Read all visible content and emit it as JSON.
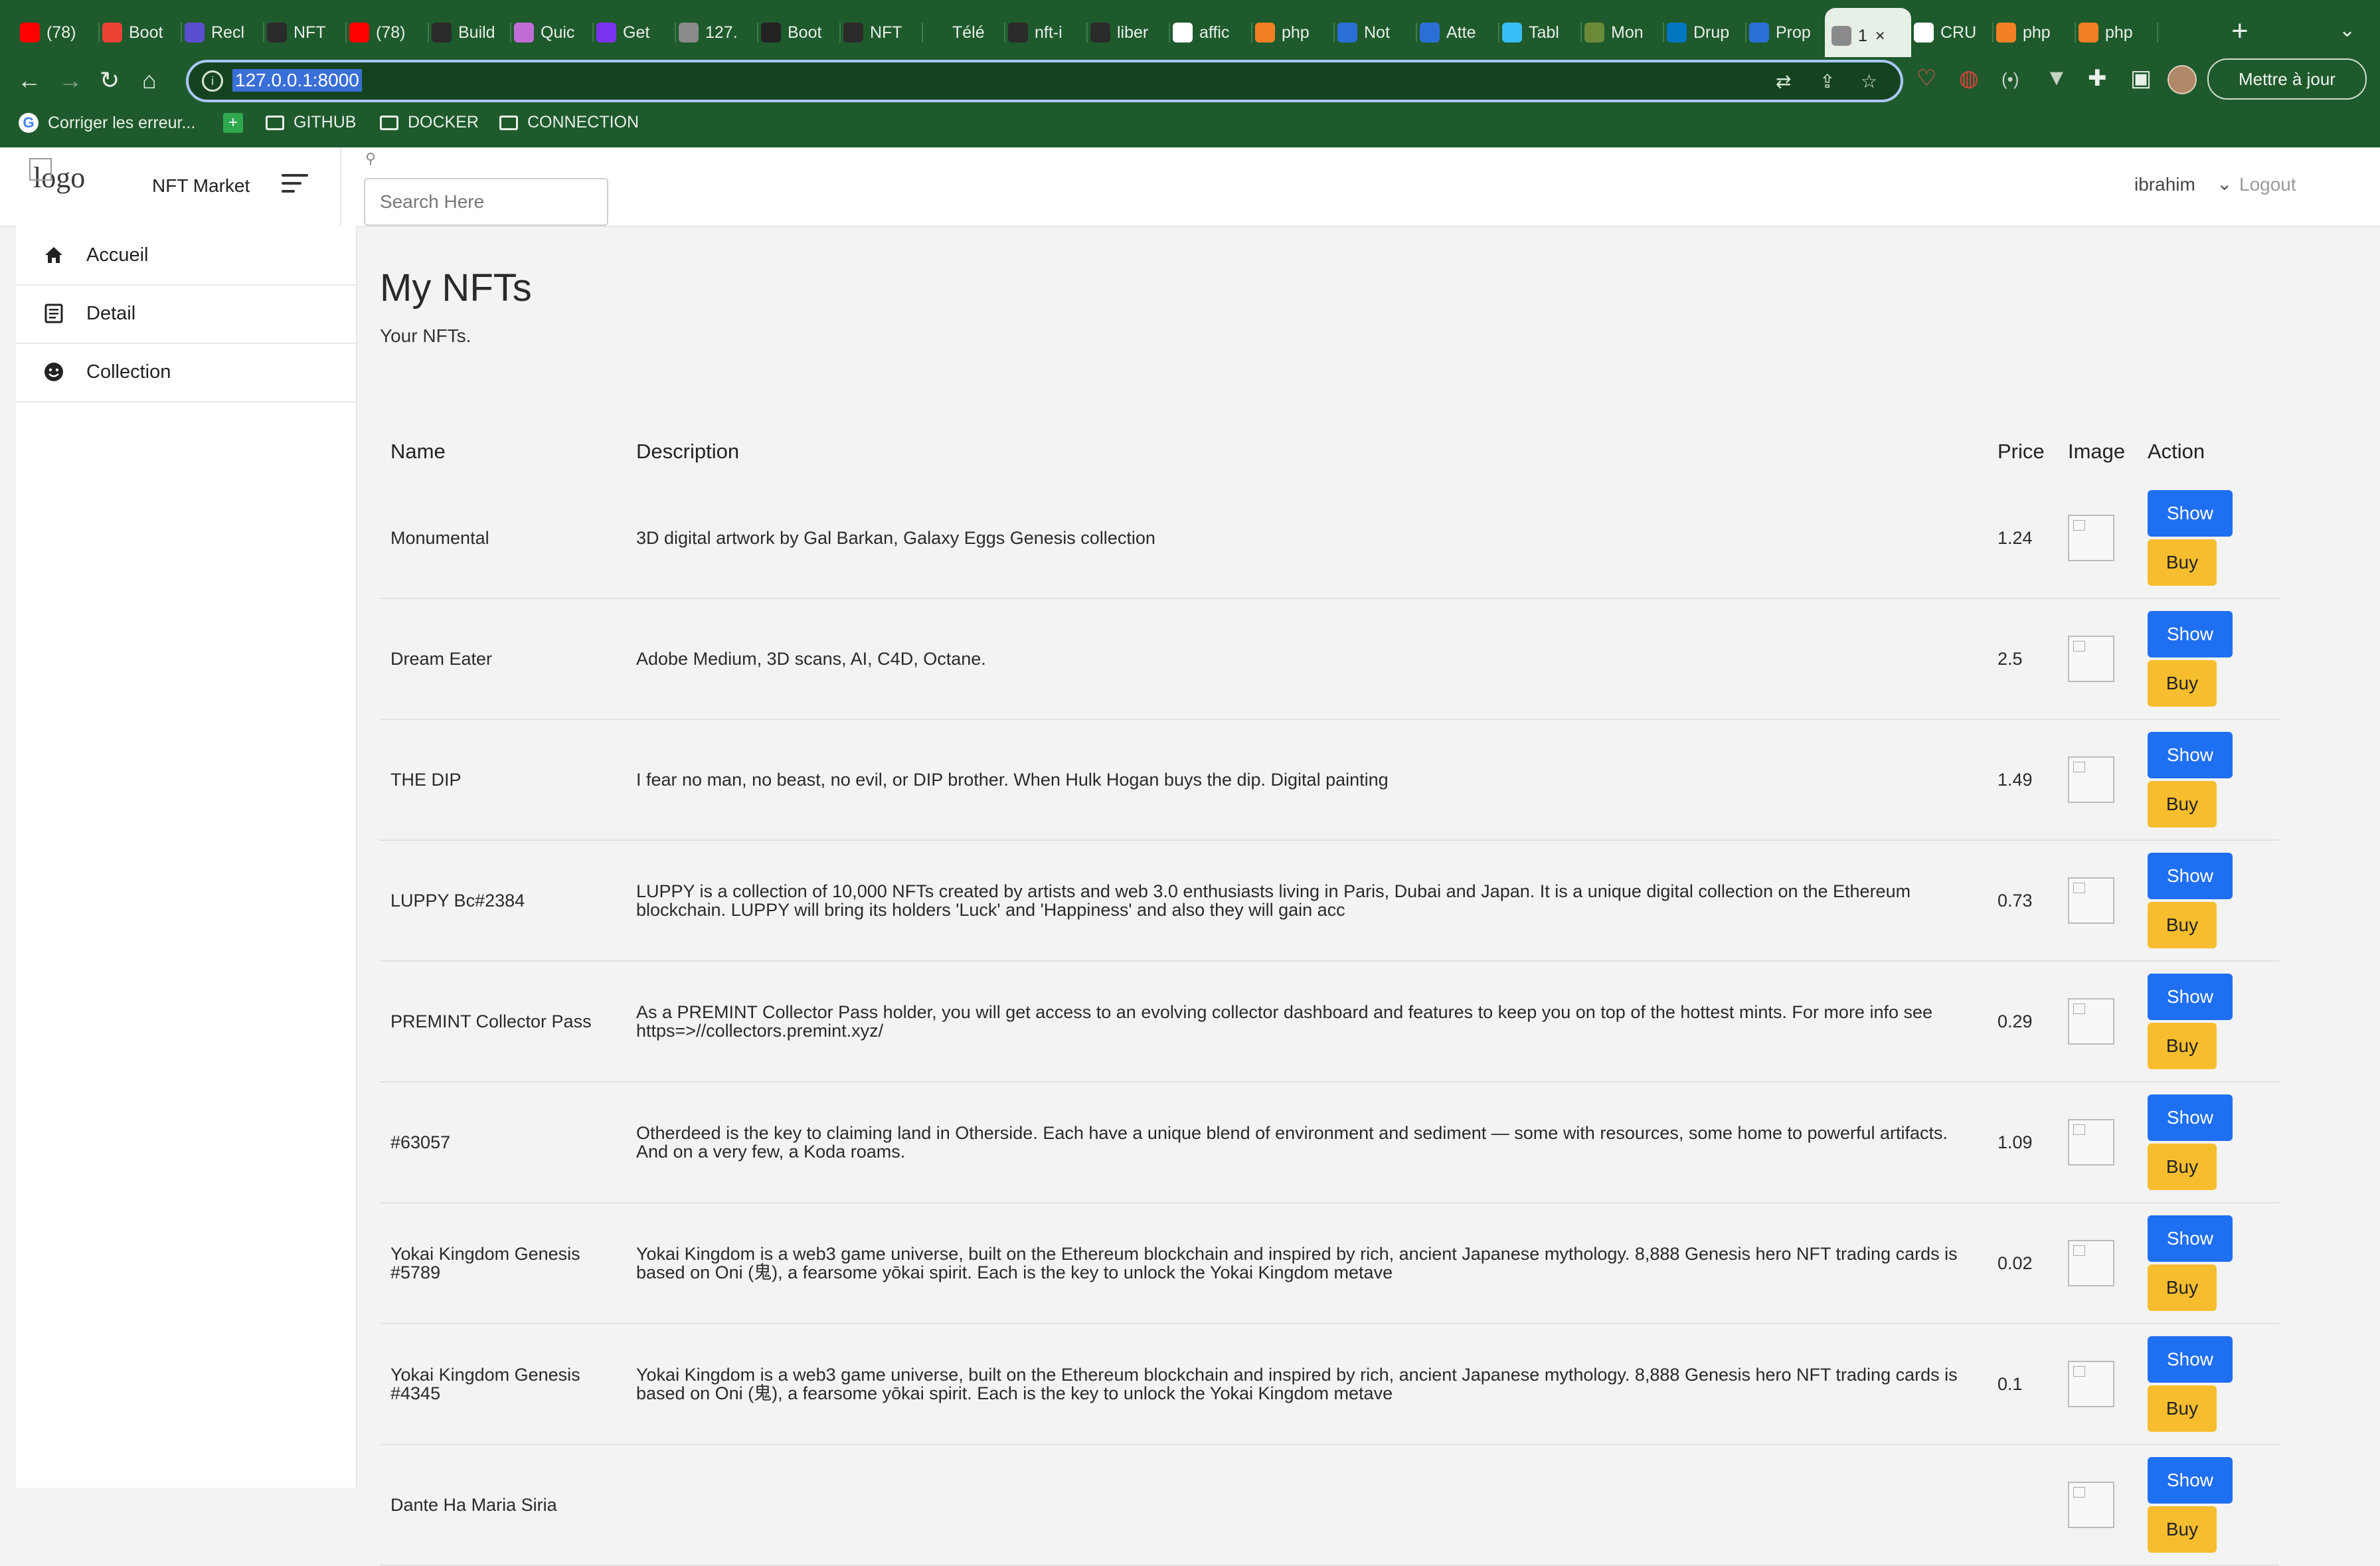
{
  "browser": {
    "tabs": [
      {
        "label": "(78)",
        "color": "#ff0000",
        "icon": "youtube-icon"
      },
      {
        "label": "Boot",
        "color": "#ea4335",
        "icon": "gmail-icon"
      },
      {
        "label": "Recl",
        "color": "#5a4fcf",
        "icon": "app-icon"
      },
      {
        "label": "NFT",
        "color": "#2b2b2b",
        "icon": "app-icon"
      },
      {
        "label": "(78)",
        "color": "#ff0000",
        "icon": "youtube-icon"
      },
      {
        "label": "Build",
        "color": "#2b2b2b",
        "icon": "app-icon"
      },
      {
        "label": "Quic",
        "color": "#c06bd6",
        "icon": "app-icon"
      },
      {
        "label": "Get",
        "color": "#7b32f0",
        "icon": "bootstrap-icon"
      },
      {
        "label": "127.",
        "color": "#8a8a8a",
        "icon": "page-icon"
      },
      {
        "label": "Boot",
        "color": "#222222",
        "icon": "github-icon"
      },
      {
        "label": "NFT",
        "color": "#2b2b2b",
        "icon": "app-icon"
      },
      {
        "label": "Télé",
        "color": "#1f5a2c",
        "icon": "download-icon"
      },
      {
        "label": "nft-i",
        "color": "#2b2b2b",
        "icon": "app-icon"
      },
      {
        "label": "liber",
        "color": "#2b2b2b",
        "icon": "app-icon"
      },
      {
        "label": "affic",
        "color": "#ffffff",
        "icon": "google-icon"
      },
      {
        "label": "php",
        "color": "#f48024",
        "icon": "stackoverflow-icon"
      },
      {
        "label": "Not",
        "color": "#2b6fd6",
        "icon": "app-icon"
      },
      {
        "label": "Atte",
        "color": "#2b6fd6",
        "icon": "app-icon"
      },
      {
        "label": "Tabl",
        "color": "#38bdf8",
        "icon": "tailwind-icon"
      },
      {
        "label": "Mon",
        "color": "#6a8a3a",
        "icon": "app-icon"
      },
      {
        "label": "Drup",
        "color": "#0077c0",
        "icon": "drupal-icon"
      },
      {
        "label": "Prop",
        "color": "#2b6fd6",
        "icon": "app-icon"
      },
      {
        "label": "1",
        "color": "#8a8a8a",
        "icon": "page-icon",
        "active": true
      },
      {
        "label": "CRU",
        "color": "#ffffff",
        "icon": "app-icon"
      },
      {
        "label": "php",
        "color": "#f48024",
        "icon": "stackoverflow-icon"
      },
      {
        "label": "php",
        "color": "#f48024",
        "icon": "stackoverflow-icon"
      }
    ],
    "url": "127.0.0.1:8000",
    "update_label": "Mettre à jour",
    "bookmarks": {
      "b1": "Corriger les erreur...",
      "b2": "GITHUB",
      "b3": "DOCKER",
      "b4": "CONNECTION"
    }
  },
  "header": {
    "logo_alt": "logo",
    "brand": "NFT Market",
    "search_placeholder": "Search Here",
    "user": "ibrahim",
    "logout": "Logout"
  },
  "sidebar": {
    "items": [
      {
        "label": "Accueil",
        "icon": "home-icon"
      },
      {
        "label": "Detail",
        "icon": "document-icon"
      },
      {
        "label": "Collection",
        "icon": "smiley-icon"
      }
    ]
  },
  "main": {
    "title": "My NFTs",
    "subtitle": "Your NFTs.",
    "columns": {
      "name": "Name",
      "description": "Description",
      "price": "Price",
      "image": "Image",
      "action": "Action"
    },
    "show_label": "Show",
    "buy_label": "Buy",
    "rows": [
      {
        "name": "Monumental",
        "description": "3D digital artwork by Gal Barkan, Galaxy Eggs Genesis collection",
        "price": "1.24"
      },
      {
        "name": "Dream Eater",
        "description": "Adobe Medium, 3D scans, AI, C4D, Octane.",
        "price": "2.5"
      },
      {
        "name": "THE DIP",
        "description": "I fear no man, no beast, no evil, or DIP brother. When Hulk Hogan buys the dip. Digital painting",
        "price": "1.49"
      },
      {
        "name": "LUPPY Bc#2384",
        "description": "LUPPY is a collection of 10,000 NFTs created by artists and web 3.0 enthusiasts living in Paris, Dubai and Japan. It is a unique digital collection on the Ethereum blockchain. LUPPY will bring its holders 'Luck' and 'Happiness' and also they will gain acc",
        "price": "0.73"
      },
      {
        "name": "PREMINT Collector Pass",
        "description": "As a PREMINT Collector Pass holder, you will get access to an evolving collector dashboard and features to keep you on top of the hottest mints. For more info see https=>//collectors.premint.xyz/",
        "price": "0.29"
      },
      {
        "name": "#63057",
        "description": "Otherdeed is the key to claiming land in Otherside. Each have a unique blend of environment and sediment — some with resources, some home to powerful artifacts. And on a very few, a Koda roams.",
        "price": "1.09"
      },
      {
        "name": "Yokai Kingdom Genesis #5789",
        "description": "Yokai Kingdom is a web3 game universe, built on the Ethereum blockchain and inspired by rich, ancient Japanese mythology. 8,888 Genesis hero NFT trading cards is based on Oni (鬼), a fearsome yōkai spirit. Each is the key to unlock the Yokai Kingdom metave",
        "price": "0.02"
      },
      {
        "name": "Yokai Kingdom Genesis #4345",
        "description": "Yokai Kingdom is a web3 game universe, built on the Ethereum blockchain and inspired by rich, ancient Japanese mythology. 8,888 Genesis hero NFT trading cards is based on Oni (鬼), a fearsome yōkai spirit. Each is the key to unlock the Yokai Kingdom metave",
        "price": "0.1"
      },
      {
        "name": "Dante Ha Maria Siria",
        "description": "",
        "price": ""
      }
    ]
  }
}
